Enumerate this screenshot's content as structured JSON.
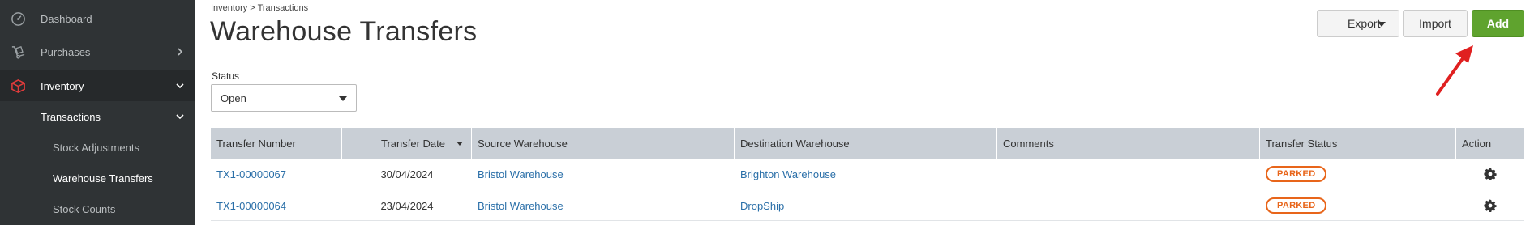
{
  "sidebar": {
    "items": [
      {
        "label": "Dashboard",
        "icon": "dashboard-icon"
      },
      {
        "label": "Purchases",
        "icon": "dolly-icon"
      },
      {
        "label": "Inventory",
        "icon": "box-icon"
      }
    ],
    "sub": {
      "label": "Transactions"
    },
    "subitems": [
      {
        "label": "Stock Adjustments"
      },
      {
        "label": "Warehouse Transfers"
      },
      {
        "label": "Stock Counts"
      }
    ],
    "colors": {
      "bg": "#2f3335",
      "active_icon": "#e23b3b"
    }
  },
  "header": {
    "breadcrumb": "Inventory > Transactions",
    "title": "Warehouse Transfers",
    "export_label": "Export",
    "import_label": "Import",
    "add_label": "Add",
    "add_color": "#5fa32e"
  },
  "filter": {
    "status_label": "Status",
    "status_value": "Open"
  },
  "table": {
    "columns": [
      "Transfer Number",
      "Transfer Date",
      "Source Warehouse",
      "Destination Warehouse",
      "Comments",
      "Transfer Status",
      "Action"
    ],
    "rows": [
      {
        "number": "TX1-00000067",
        "date": "30/04/2024",
        "source": "Bristol Warehouse",
        "destination": "Brighton Warehouse",
        "comments": "",
        "status": "PARKED",
        "action_icon": "gear-icon"
      },
      {
        "number": "TX1-00000064",
        "date": "23/04/2024",
        "source": "Bristol Warehouse",
        "destination": "DropShip",
        "comments": "",
        "status": "PARKED",
        "action_icon": "gear-icon"
      }
    ]
  }
}
